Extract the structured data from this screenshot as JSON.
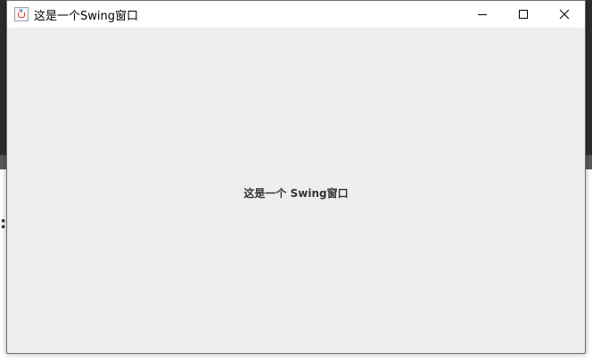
{
  "window": {
    "title": "这是一个Swing窗口",
    "label": "这是一个 Swing窗口",
    "icon": "java-cup-icon",
    "controls": [
      "minimize-icon",
      "maximize-icon",
      "close-icon"
    ]
  },
  "background": {
    "colon": ":"
  },
  "colors": {
    "content_bg": "#eeeeee",
    "titlebar_bg": "#ffffff",
    "desktop_dark": "#2b2d30"
  }
}
